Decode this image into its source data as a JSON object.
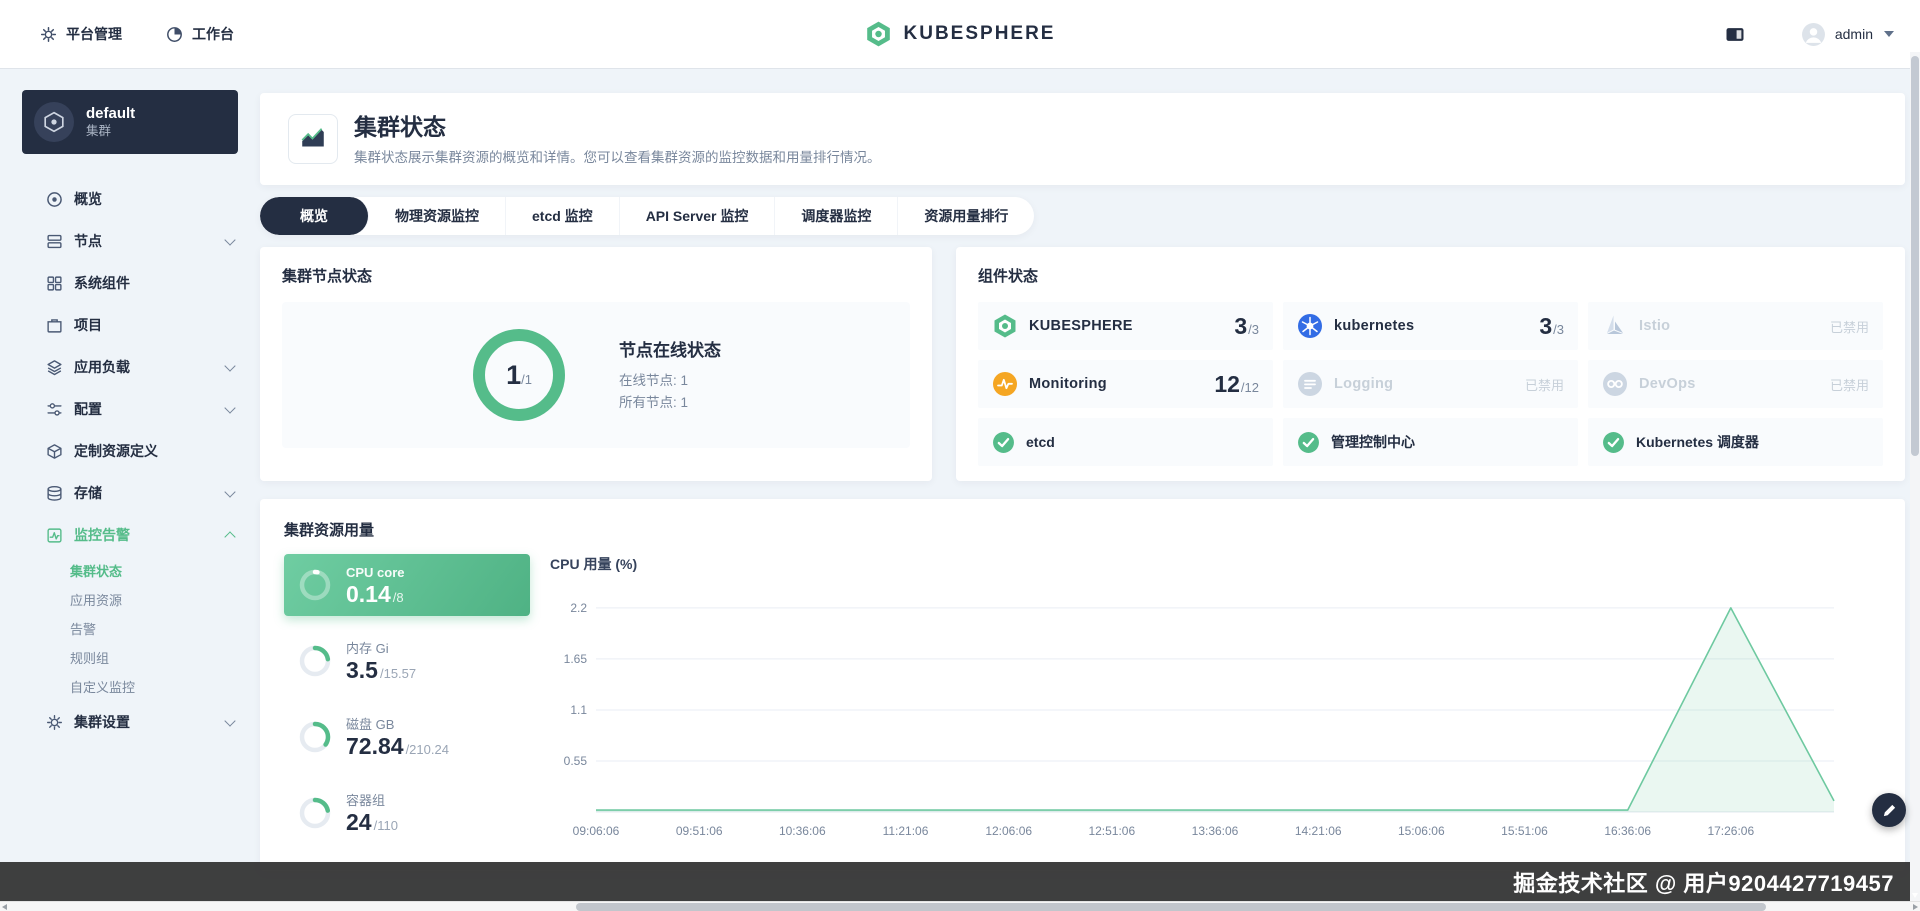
{
  "colors": {
    "accent": "#55bc8a",
    "dark": "#242e42",
    "kubernetes_blue": "#326ce5",
    "monitoring_orange": "#f5a623"
  },
  "header": {
    "platform_label": "平台管理",
    "workbench_label": "工作台",
    "brand": "KUBESPHERE",
    "user": "admin"
  },
  "sidebar": {
    "cluster": {
      "name": "default",
      "type": "集群"
    },
    "items": [
      {
        "label": "概览",
        "icon": "overview-icon"
      },
      {
        "label": "节点",
        "icon": "nodes-icon",
        "chevron": "down"
      },
      {
        "label": "系统组件",
        "icon": "components-icon"
      },
      {
        "label": "项目",
        "icon": "projects-icon"
      },
      {
        "label": "应用负载",
        "icon": "workloads-icon",
        "chevron": "down"
      },
      {
        "label": "配置",
        "icon": "config-icon",
        "chevron": "down"
      },
      {
        "label": "定制资源定义",
        "icon": "crd-icon"
      },
      {
        "label": "存储",
        "icon": "storage-icon",
        "chevron": "down"
      },
      {
        "label": "监控告警",
        "icon": "monitoring-icon",
        "chevron": "up",
        "active": true,
        "children": [
          {
            "label": "集群状态",
            "active": true
          },
          {
            "label": "应用资源"
          },
          {
            "label": "告警"
          },
          {
            "label": "规则组"
          },
          {
            "label": "自定义监控"
          }
        ]
      },
      {
        "label": "集群设置",
        "icon": "settings-icon",
        "chevron": "down"
      }
    ]
  },
  "page": {
    "title": "集群状态",
    "description": "集群状态展示集群资源的概览和详情。您可以查看集群资源的监控数据和用量排行情况。",
    "tabs": [
      {
        "label": "概览",
        "active": true
      },
      {
        "label": "物理资源监控"
      },
      {
        "label": "etcd 监控"
      },
      {
        "label": "API Server 监控"
      },
      {
        "label": "调度器监控"
      },
      {
        "label": "资源用量排行"
      }
    ]
  },
  "node_status": {
    "title": "集群节点状态",
    "value": "1",
    "total": "1",
    "heading": "节点在线状态",
    "online_label": "在线节点: 1",
    "all_label": "所有节点: 1"
  },
  "components": {
    "title": "组件状态",
    "items": [
      {
        "name": "KUBESPHERE",
        "icon": "kubesphere-icon",
        "value": "3",
        "total": "3"
      },
      {
        "name": "kubernetes",
        "icon": "kubernetes-icon",
        "value": "3",
        "total": "3"
      },
      {
        "name": "Istio",
        "icon": "istio-icon",
        "disabled": true,
        "status": "已禁用"
      },
      {
        "name": "Monitoring",
        "icon": "monitoring-colored-icon",
        "value": "12",
        "total": "12"
      },
      {
        "name": "Logging",
        "icon": "logging-icon",
        "disabled": true,
        "status": "已禁用"
      },
      {
        "name": "DevOps",
        "icon": "devops-icon",
        "disabled": true,
        "status": "已禁用"
      }
    ],
    "checks": [
      {
        "label": "etcd"
      },
      {
        "label": "管理控制中心"
      },
      {
        "label": "Kubernetes 调度器"
      }
    ]
  },
  "usage": {
    "title": "集群资源用量",
    "metrics": [
      {
        "name": "CPU core",
        "value": "0.14",
        "total": "8",
        "active": true
      },
      {
        "name": "内存 Gi",
        "value": "3.5",
        "total": "15.57"
      },
      {
        "name": "磁盘 GB",
        "value": "72.84",
        "total": "210.24"
      },
      {
        "name": "容器组",
        "value": "24",
        "total": "110"
      }
    ]
  },
  "chart_data": {
    "type": "line",
    "title": "CPU 用量  (%)",
    "xlabel": "",
    "ylabel": "",
    "x_labels": [
      "09:06:06",
      "09:51:06",
      "10:36:06",
      "11:21:06",
      "12:06:06",
      "12:51:06",
      "13:36:06",
      "14:21:06",
      "15:06:06",
      "15:51:06",
      "16:36:06",
      "17:26:06"
    ],
    "yticks": [
      0.55,
      1.1,
      1.65,
      2.2
    ],
    "ylim": [
      0,
      2.35
    ],
    "grid": true,
    "legend_position": "none",
    "series": [
      {
        "name": "CPU 用量",
        "color": "#6ec9a0",
        "fill": "rgba(85,188,138,0.12)",
        "values": [
          0.02,
          0.02,
          0.02,
          0.02,
          0.02,
          0.02,
          0.02,
          0.02,
          0.02,
          0.02,
          0.02,
          2.2,
          0.12
        ]
      }
    ]
  },
  "watermark": {
    "text": "掘金技术社区 @ 用户9204427719457"
  }
}
